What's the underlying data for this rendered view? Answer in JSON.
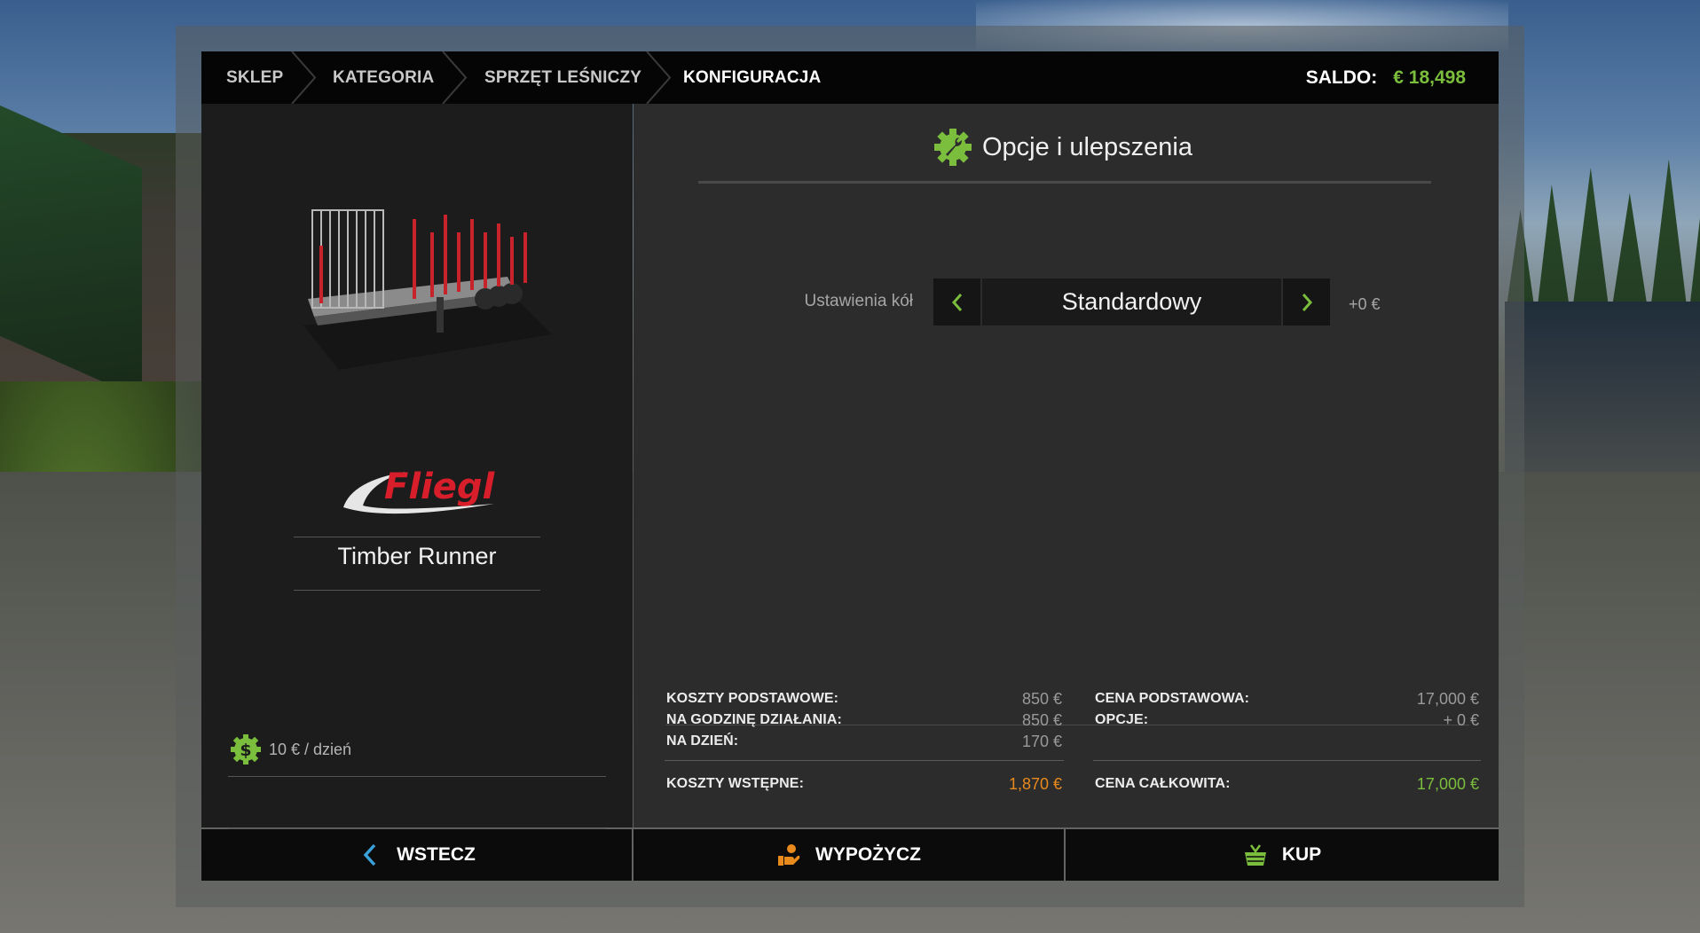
{
  "breadcrumb": [
    {
      "label": "SKLEP"
    },
    {
      "label": "KATEGORIA"
    },
    {
      "label": "SPRZĘT LEŚNICZY"
    },
    {
      "label": "KONFIGURACJA"
    }
  ],
  "balance": {
    "label": "SALDO:",
    "value": "€ 18,498"
  },
  "vehicle": {
    "brand": "Fliegl",
    "name": "Timber Runner"
  },
  "rent": {
    "text": "10 € / dzień",
    "icon": "dollar-icon"
  },
  "options": {
    "title": "Opcje i ulepszenia",
    "icon": "wrench-gear-icon",
    "settings": [
      {
        "label": "Ustawienia kół",
        "value": "Standardowy",
        "price": "+0 €"
      }
    ]
  },
  "costs": {
    "left": [
      {
        "label": "KOSZTY PODSTAWOWE:",
        "value": "850 €"
      },
      {
        "label": "NA GODZINĘ DZIAŁANIA:",
        "value": "850 €"
      },
      {
        "label": "NA DZIEŃ:",
        "value": "170 €"
      }
    ],
    "left_total": {
      "label": "KOSZTY WSTĘPNE:",
      "value": "1,870 €"
    },
    "right": [
      {
        "label": "CENA PODSTAWOWA:",
        "value": "17,000 €"
      },
      {
        "label": "OPCJE:",
        "value": "+ 0 €"
      }
    ],
    "right_total": {
      "label": "CENA CAŁKOWITA:",
      "value": "17,000 €"
    }
  },
  "buttons": {
    "back": "WSTECZ",
    "lease": "WYPOŻYCZ",
    "buy": "KUP"
  },
  "colors": {
    "accent_green": "#7bbd3c",
    "accent_orange": "#e88a1c",
    "accent_blue": "#3aa0d8",
    "brand_red": "#d81e2a"
  }
}
